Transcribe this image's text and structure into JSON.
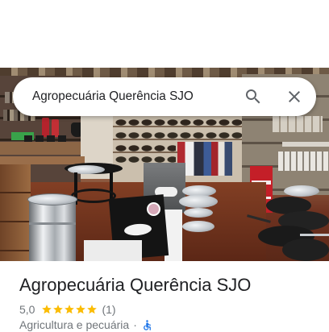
{
  "search": {
    "query": "Agropecuária Querência SJO",
    "search_icon": "search-icon",
    "close_icon": "close-icon"
  },
  "place": {
    "name": "Agropecuária Querência SJO",
    "rating": "5,0",
    "star_count": 5,
    "review_count": "(1)",
    "category": "Agricultura e pecuária",
    "separator": "·",
    "accessibility_icon": "wheelchair-icon"
  },
  "colors": {
    "text_primary": "#202124",
    "text_secondary": "#70757a",
    "icon": "#5f6368",
    "star": "#fbbc04",
    "accessibility": "#1a73e8"
  }
}
